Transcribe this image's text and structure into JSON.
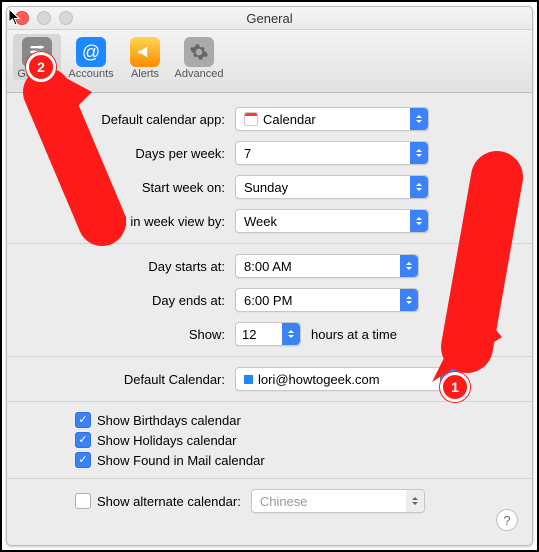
{
  "window_title": "General",
  "toolbar": [
    {
      "key": "general",
      "label": "General"
    },
    {
      "key": "accounts",
      "label": "Accounts"
    },
    {
      "key": "alerts",
      "label": "Alerts"
    },
    {
      "key": "advanced",
      "label": "Advanced"
    }
  ],
  "rows": {
    "default_app": {
      "label": "Default calendar app:",
      "value": "Calendar"
    },
    "days_per_week": {
      "label": "Days per week:",
      "value": "7"
    },
    "start_week_on": {
      "label": "Start week on:",
      "value": "Sunday"
    },
    "scroll_week_view": {
      "label": "Scroll in week view by:",
      "value": "Week"
    },
    "day_starts": {
      "label": "Day starts at:",
      "value": "8:00 AM"
    },
    "day_ends": {
      "label": "Day ends at:",
      "value": "6:00 PM"
    },
    "show_hours": {
      "label": "Show:",
      "value": "12",
      "suffix": "hours at a time"
    },
    "default_calendar": {
      "label": "Default Calendar:",
      "value": "lori@howtogeek.com"
    }
  },
  "checkboxes": {
    "birthdays": {
      "label": "Show Birthdays calendar",
      "checked": true
    },
    "holidays": {
      "label": "Show Holidays calendar",
      "checked": true
    },
    "mail": {
      "label": "Show Found in Mail calendar",
      "checked": true
    },
    "alternate": {
      "label": "Show alternate calendar:",
      "checked": false,
      "value": "Chinese"
    }
  },
  "annotations": {
    "badge1": "1",
    "badge2": "2"
  }
}
